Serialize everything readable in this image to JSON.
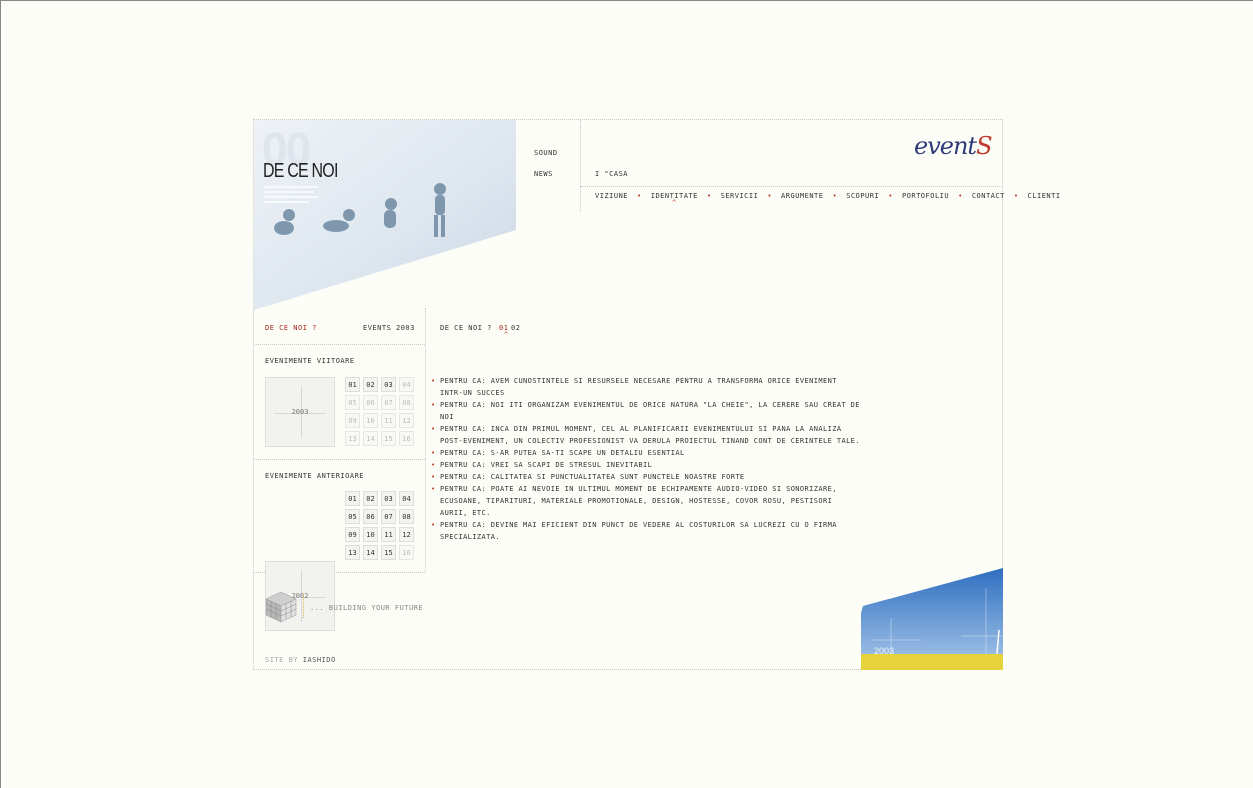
{
  "hero": {
    "big_number": "00",
    "title": "DE CE NOI",
    "top_links": [
      "sound",
      "news"
    ]
  },
  "logo": {
    "text": "event",
    "accent": "S"
  },
  "breadcrumb": "i \"casa",
  "nav": [
    "viziune",
    "identitate",
    "servicii",
    "argumente",
    "scopuri",
    "portofoliu",
    "contact",
    "clienti"
  ],
  "sidebar": {
    "tab_active": "de ce noi ?",
    "tab_other": "events 2003",
    "upcoming": {
      "title": "evenimente viitoare",
      "year": "2003",
      "days": [
        {
          "n": "01",
          "on": true
        },
        {
          "n": "02",
          "on": true
        },
        {
          "n": "03",
          "on": true
        },
        {
          "n": "04",
          "on": false
        },
        {
          "n": "05",
          "on": false
        },
        {
          "n": "06",
          "on": false
        },
        {
          "n": "07",
          "on": false
        },
        {
          "n": "08",
          "on": false
        },
        {
          "n": "09",
          "on": false
        },
        {
          "n": "10",
          "on": false
        },
        {
          "n": "11",
          "on": false
        },
        {
          "n": "12",
          "on": false
        },
        {
          "n": "13",
          "on": false
        },
        {
          "n": "14",
          "on": false
        },
        {
          "n": "15",
          "on": false
        },
        {
          "n": "16",
          "on": false
        }
      ]
    },
    "previous": {
      "title": "evenimente anterioare",
      "year": "2002",
      "days": [
        {
          "n": "01",
          "on": true
        },
        {
          "n": "02",
          "on": true
        },
        {
          "n": "03",
          "on": true
        },
        {
          "n": "04",
          "on": true
        },
        {
          "n": "05",
          "on": true
        },
        {
          "n": "06",
          "on": true
        },
        {
          "n": "07",
          "on": true
        },
        {
          "n": "08",
          "on": true
        },
        {
          "n": "09",
          "on": true
        },
        {
          "n": "10",
          "on": true
        },
        {
          "n": "11",
          "on": true
        },
        {
          "n": "12",
          "on": true
        },
        {
          "n": "13",
          "on": true
        },
        {
          "n": "14",
          "on": true
        },
        {
          "n": "15",
          "on": true
        },
        {
          "n": "16",
          "on": false
        }
      ]
    }
  },
  "content": {
    "heading": "de ce noi ?",
    "pages": [
      "01",
      "02"
    ],
    "reasons": [
      "pentru ca: avem cunostintele si resursele necesare pentru a transforma orice eveniment intr-un succes",
      "pentru ca: noi iti organizam evenimentul de orice natura \"la cheie\", la cerere sau creat de noi",
      "pentru ca: inca din primul moment, cel al planificarii evenimentului si pana la analiza post-eveniment, un colectiv profesionist va derula proiectul tinand cont de cerintele tale.",
      "pentru ca: s-ar putea sa-ti scape un detaliu esential",
      "pentru ca: vrei sa scapi de stresul inevitabil",
      "pentru ca: calitatea si punctualitatea sunt punctele noastre forte",
      "pentru ca: poate ai nevoie in ultimul moment de echipamente audio-video si sonorizare, ecusoane, tiparituri, materiale promotionale, design, hostesse, covor rosu, pestisori aurii, etc.",
      "pentru ca: devine mai eficient din punct de vedere al costurilor sa lucrezi cu o firma specializata."
    ]
  },
  "footer": {
    "tagline": "... building your future",
    "credit_prefix": "site by",
    "credit_name": "iashido",
    "photo_year": "2003"
  },
  "colors": {
    "accent": "#c0392b",
    "logo_blue": "#2e3a7a",
    "background": "#fcfdf6"
  }
}
